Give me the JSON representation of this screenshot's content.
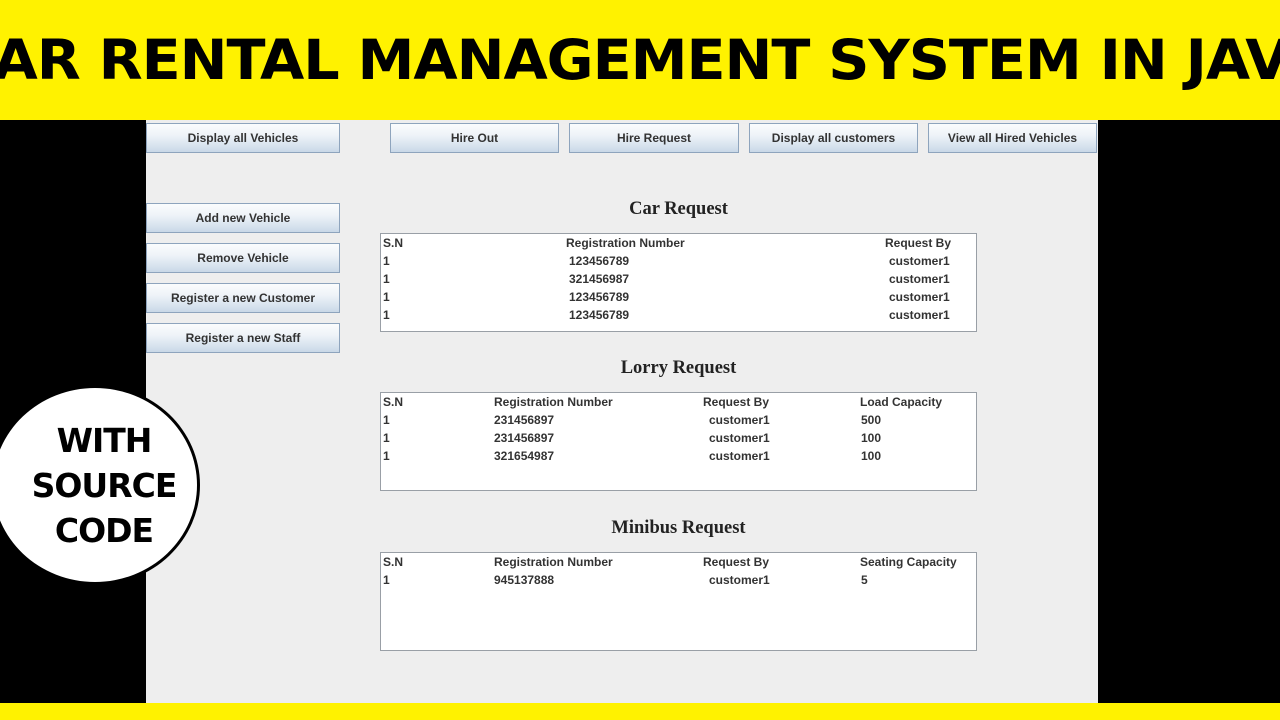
{
  "banner": {
    "title": "CAR RENTAL MANAGEMENT SYSTEM IN JAVA"
  },
  "badge": {
    "lines": [
      "WITH",
      "SOURCE",
      "CODE"
    ]
  },
  "sidebar": {
    "top_button": "Display all Vehicles",
    "buttons": [
      "Add new Vehicle",
      "Remove Vehicle",
      "Register a new Customer",
      "Register a new Staff"
    ]
  },
  "toolbar": {
    "buttons": [
      "Hire Out",
      "Hire Request",
      "Display all customers",
      "View all Hired Vehicles"
    ]
  },
  "car_request": {
    "title": "Car Request",
    "headers": [
      "S.N",
      "Registration Number",
      "Request By"
    ],
    "rows": [
      [
        "1",
        "123456789",
        "customer1"
      ],
      [
        "1",
        "321456987",
        "customer1"
      ],
      [
        "1",
        "123456789",
        "customer1"
      ],
      [
        "1",
        "123456789",
        "customer1"
      ]
    ]
  },
  "lorry_request": {
    "title": "Lorry Request",
    "headers": [
      "S.N",
      "Registration Number",
      "Request By",
      "Load Capacity"
    ],
    "rows": [
      [
        "1",
        "231456897",
        "customer1",
        "500"
      ],
      [
        "1",
        "231456897",
        "customer1",
        "100"
      ],
      [
        "1",
        "321654987",
        "customer1",
        "100"
      ]
    ]
  },
  "minibus_request": {
    "title": "Minibus Request",
    "headers": [
      "S.N",
      "Registration Number",
      "Request By",
      "Seating Capacity"
    ],
    "rows": [
      [
        "1",
        "945137888",
        "customer1",
        "5"
      ]
    ]
  },
  "colors": {
    "banner_bg": "#fff200",
    "window_bg": "#eeeeee",
    "button_border": "#8ea4bd"
  }
}
